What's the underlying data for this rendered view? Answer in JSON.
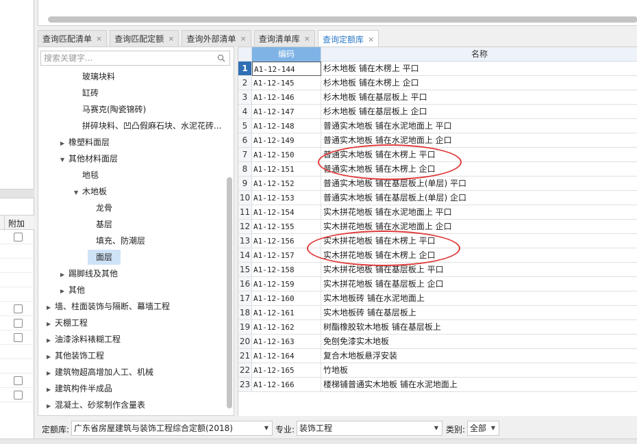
{
  "tabs": [
    {
      "label": "查询匹配清单",
      "active": false
    },
    {
      "label": "查询匹配定额",
      "active": false
    },
    {
      "label": "查询外部清单",
      "active": false
    },
    {
      "label": "查询清单库",
      "active": false
    },
    {
      "label": "查询定额库",
      "active": true
    }
  ],
  "tab_close_glyph": "×",
  "left_panel": {
    "column_header": "附加",
    "checkbox_rows": 8
  },
  "search": {
    "placeholder": "搜索关键字..."
  },
  "tree": [
    {
      "label": "玻璃块料",
      "level": 3,
      "arrow": ""
    },
    {
      "label": "缸砖",
      "level": 3,
      "arrow": ""
    },
    {
      "label": "马赛克(陶瓷锦砖)",
      "level": 3,
      "arrow": ""
    },
    {
      "label": "拼碎块料、凹凸假麻石块、水泥花砖...",
      "level": 3,
      "arrow": ""
    },
    {
      "label": "橡塑料面层",
      "level": 2,
      "arrow": "▶"
    },
    {
      "label": "其他材料面层",
      "level": 2,
      "arrow": "▼"
    },
    {
      "label": "地毯",
      "level": 3,
      "arrow": ""
    },
    {
      "label": "木地板",
      "level": 3,
      "arrow": "▼"
    },
    {
      "label": "龙骨",
      "level": 4,
      "arrow": ""
    },
    {
      "label": "基层",
      "level": 4,
      "arrow": ""
    },
    {
      "label": "填充、防潮层",
      "level": 4,
      "arrow": ""
    },
    {
      "label": "面层",
      "level": 4,
      "arrow": "",
      "selected": true
    },
    {
      "label": "踢脚线及其他",
      "level": 2,
      "arrow": "▶"
    },
    {
      "label": "其他",
      "level": 2,
      "arrow": "▶"
    },
    {
      "label": "墙、柱面装饰与隔断、幕墙工程",
      "level": 1,
      "arrow": "▶"
    },
    {
      "label": "天棚工程",
      "level": 1,
      "arrow": "▶"
    },
    {
      "label": "油漆涂料裱糊工程",
      "level": 1,
      "arrow": "▶"
    },
    {
      "label": "其他装饰工程",
      "level": 1,
      "arrow": "▶"
    },
    {
      "label": "建筑物超高增加人工、机械",
      "level": 1,
      "arrow": "▶"
    },
    {
      "label": "建筑构件半成品",
      "level": 1,
      "arrow": "▶"
    },
    {
      "label": "混凝土、砂浆制作含量表",
      "level": 1,
      "arrow": "▶"
    }
  ],
  "grid": {
    "headers": {
      "code": "编码",
      "name": "名称"
    },
    "rows": [
      {
        "n": "1",
        "code": "A1-12-144",
        "name": "杉木地板 铺在木楞上 平口"
      },
      {
        "n": "2",
        "code": "A1-12-145",
        "name": "杉木地板 铺在木楞上 企口"
      },
      {
        "n": "3",
        "code": "A1-12-146",
        "name": "杉木地板 铺在基层板上 平口"
      },
      {
        "n": "4",
        "code": "A1-12-147",
        "name": "杉木地板 铺在基层板上 企口"
      },
      {
        "n": "5",
        "code": "A1-12-148",
        "name": "普通实木地板 铺在水泥地面上 平口"
      },
      {
        "n": "6",
        "code": "A1-12-149",
        "name": "普通实木地板 铺在水泥地面上 企口"
      },
      {
        "n": "7",
        "code": "A1-12-150",
        "name": "普通实木地板 铺在木楞上 平口"
      },
      {
        "n": "8",
        "code": "A1-12-151",
        "name": "普通实木地板 铺在木楞上 企口"
      },
      {
        "n": "9",
        "code": "A1-12-152",
        "name": "普通实木地板 铺在基层板上(单层) 平口"
      },
      {
        "n": "10",
        "code": "A1-12-153",
        "name": "普通实木地板 铺在基层板上(单层) 企口"
      },
      {
        "n": "11",
        "code": "A1-12-154",
        "name": "实木拼花地板 铺在水泥地面上 平口"
      },
      {
        "n": "12",
        "code": "A1-12-155",
        "name": "实木拼花地板 铺在水泥地面上 企口"
      },
      {
        "n": "13",
        "code": "A1-12-156",
        "name": "实木拼花地板 铺在木楞上 平口"
      },
      {
        "n": "14",
        "code": "A1-12-157",
        "name": "实木拼花地板 铺在木楞上 企口"
      },
      {
        "n": "15",
        "code": "A1-12-158",
        "name": "实木拼花地板 铺在基层板上 平口"
      },
      {
        "n": "16",
        "code": "A1-12-159",
        "name": "实木拼花地板 铺在基层板上 企口"
      },
      {
        "n": "17",
        "code": "A1-12-160",
        "name": "实木地板砖 铺在水泥地面上"
      },
      {
        "n": "18",
        "code": "A1-12-161",
        "name": "实木地板砖 铺在基层板上"
      },
      {
        "n": "19",
        "code": "A1-12-162",
        "name": "树酯橡胶软木地板 铺在基层板上"
      },
      {
        "n": "20",
        "code": "A1-12-163",
        "name": "免刨免漆实木地板"
      },
      {
        "n": "21",
        "code": "A1-12-164",
        "name": "复合木地板悬浮安装"
      },
      {
        "n": "22",
        "code": "A1-12-165",
        "name": "竹地板"
      },
      {
        "n": "23",
        "code": "A1-12-166",
        "name": "楼梯铺普通实木地板 铺在水泥地面上"
      }
    ]
  },
  "bottom": {
    "quota_label": "定额库:",
    "quota_value": "广东省房屋建筑与装饰工程综合定额(2018)",
    "major_label": "专业:",
    "major_value": "装饰工程",
    "category_label": "类别:",
    "category_value": "全部"
  },
  "colors": {
    "accent": "#2b78c8",
    "annotation": "#e03a3a",
    "header_selected": "#7fb3e6"
  }
}
